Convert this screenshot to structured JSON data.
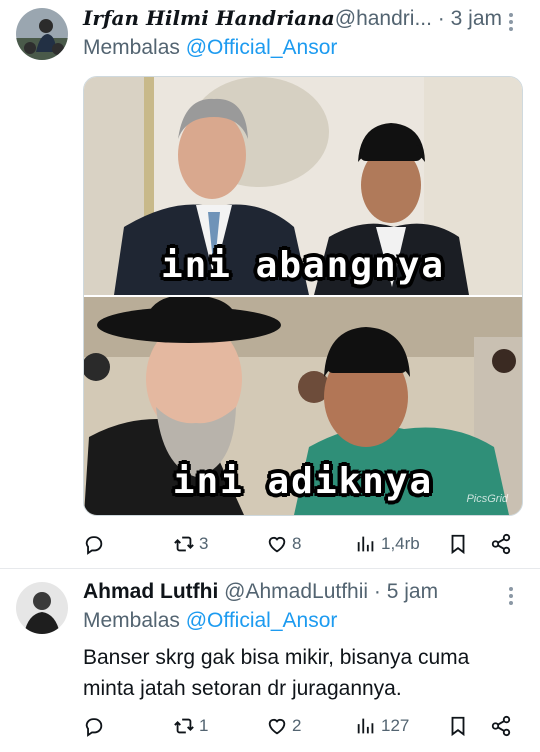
{
  "tweet1": {
    "display_name": "Irfan Hilmi Handriana",
    "handle": "@handri...",
    "sep": "·",
    "time": "3 jam",
    "reply_prefix": "Membalas",
    "reply_to": "@Official_Ansor",
    "media": {
      "caption_top": "ini abangnya",
      "caption_bottom": "ini adiknya",
      "watermark": "PicsGrid"
    },
    "actions": {
      "reply_icon": "reply-icon",
      "retweet_count": "3",
      "like_count": "8",
      "views_count": "1,4rb"
    }
  },
  "tweet2": {
    "display_name": "Ahmad Lutfhi",
    "handle": "@AhmadLutfhii",
    "sep": "·",
    "time": "5 jam",
    "reply_prefix": "Membalas",
    "reply_to": "@Official_Ansor",
    "text_line1": "Banser skrg gak bisa mikir, bisanya cuma",
    "text_line2": "minta jatah setoran dr juragannya.",
    "actions": {
      "retweet_count": "1",
      "like_count": "2",
      "views_count": "127"
    }
  },
  "colors": {
    "accent": "#1d9bf0",
    "muted": "#536471",
    "divider": "#e7e9ec"
  }
}
